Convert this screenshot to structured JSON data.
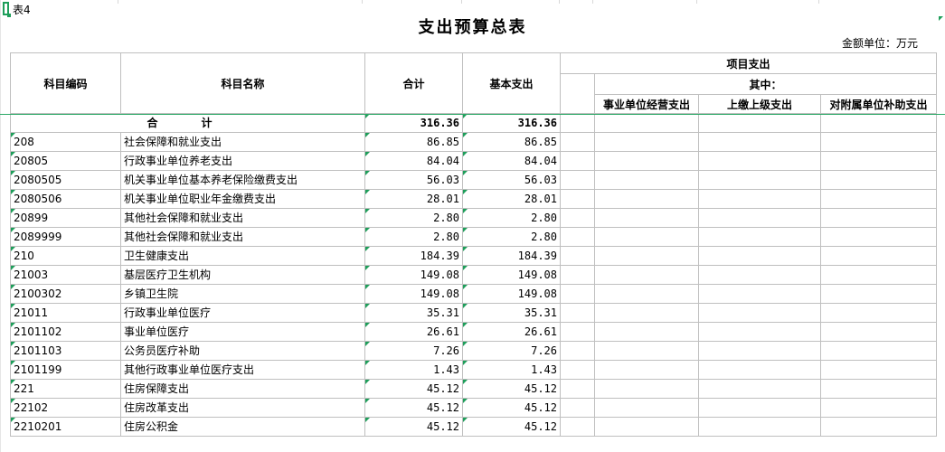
{
  "sheet_label": "表4",
  "title": "支出预算总表",
  "unit": "金额单位：万元",
  "headers": {
    "code": "科目编码",
    "name": "科目名称",
    "total": "合计",
    "basic": "基本支出",
    "project": "项目支出",
    "among": "其中：",
    "sub1": "事业单位经营支出",
    "sub2": "上缴上级支出",
    "sub3": "对附属单位补助支出"
  },
  "total_row": {
    "label": "合　计",
    "total": "316.36",
    "basic": "316.36"
  },
  "rows": [
    {
      "code": "208",
      "name": "社会保障和就业支出",
      "total": "86.85",
      "basic": "86.85"
    },
    {
      "code": "20805",
      "name": "行政事业单位养老支出",
      "total": "84.04",
      "basic": "84.04"
    },
    {
      "code": "2080505",
      "name": "机关事业单位基本养老保险缴费支出",
      "total": "56.03",
      "basic": "56.03"
    },
    {
      "code": "2080506",
      "name": "机关事业单位职业年金缴费支出",
      "total": "28.01",
      "basic": "28.01"
    },
    {
      "code": "20899",
      "name": "其他社会保障和就业支出",
      "total": "2.80",
      "basic": "2.80"
    },
    {
      "code": "2089999",
      "name": "其他社会保障和就业支出",
      "total": "2.80",
      "basic": "2.80"
    },
    {
      "code": "210",
      "name": "卫生健康支出",
      "total": "184.39",
      "basic": "184.39"
    },
    {
      "code": "21003",
      "name": "基层医疗卫生机构",
      "total": "149.08",
      "basic": "149.08"
    },
    {
      "code": "2100302",
      "name": "乡镇卫生院",
      "total": "149.08",
      "basic": "149.08"
    },
    {
      "code": "21011",
      "name": "行政事业单位医疗",
      "total": "35.31",
      "basic": "35.31"
    },
    {
      "code": "2101102",
      "name": "事业单位医疗",
      "total": "26.61",
      "basic": "26.61"
    },
    {
      "code": "2101103",
      "name": "公务员医疗补助",
      "total": "7.26",
      "basic": "7.26"
    },
    {
      "code": "2101199",
      "name": "其他行政事业单位医疗支出",
      "total": "1.43",
      "basic": "1.43"
    },
    {
      "code": "221",
      "name": "住房保障支出",
      "total": "45.12",
      "basic": "45.12"
    },
    {
      "code": "22102",
      "name": "住房改革支出",
      "total": "45.12",
      "basic": "45.12"
    },
    {
      "code": "2210201",
      "name": "住房公积金",
      "total": "45.12",
      "basic": "45.12"
    }
  ],
  "colors": {
    "accent": "#1e9e5a",
    "grid": "#bfbfbf"
  }
}
